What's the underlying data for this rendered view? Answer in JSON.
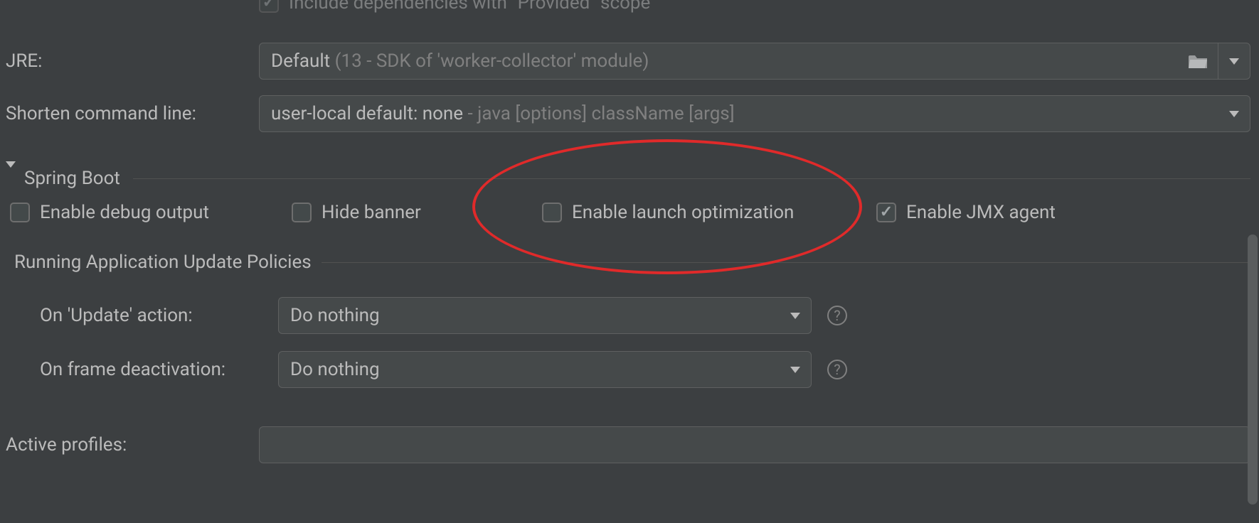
{
  "colors": {
    "bg": "#3C3F41",
    "panel": "#45494A",
    "border": "#5E6060",
    "text": "#BBBBBB",
    "muted": "#808080",
    "annotation": "#E02A2A"
  },
  "partial_checkbox": {
    "checked": true,
    "label": "Include dependencies with \"Provided\" scope"
  },
  "jre": {
    "label": "JRE:",
    "value": "Default",
    "suffix": " (13 - SDK of 'worker-collector' module)"
  },
  "shorten": {
    "label": "Shorten command line:",
    "value": "user-local default: none",
    "suffix": " - java [options] className [args]"
  },
  "section": {
    "title": "Spring Boot"
  },
  "checkboxes": {
    "debug": {
      "label": "Enable debug output",
      "checked": false
    },
    "hide": {
      "label": "Hide banner",
      "checked": false
    },
    "launch": {
      "label": "Enable launch optimization",
      "checked": false
    },
    "jmx": {
      "label": "Enable JMX agent",
      "checked": true
    }
  },
  "policies_section": "Running Application Update Policies",
  "policies": {
    "update": {
      "label": "On 'Update' action:",
      "value": "Do nothing"
    },
    "frame": {
      "label": "On frame deactivation:",
      "value": "Do nothing"
    }
  },
  "active_profiles": {
    "label": "Active profiles:",
    "value": ""
  },
  "help_glyph": "?"
}
